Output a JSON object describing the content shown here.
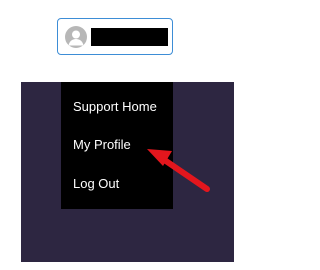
{
  "user_chip": {
    "avatar_icon": "user-avatar-icon"
  },
  "menu": {
    "items": [
      {
        "label": "Support Home"
      },
      {
        "label": "My Profile"
      },
      {
        "label": "Log Out"
      }
    ]
  },
  "colors": {
    "chip_border": "#3d8dd6",
    "avatar_bg": "#b7b7b7",
    "panel_bg": "#2d2641",
    "menu_bg": "#000000",
    "menu_text": "#ffffff",
    "arrow": "#e3161d"
  },
  "annotation": {
    "arrow_icon": "red-arrow-icon"
  }
}
